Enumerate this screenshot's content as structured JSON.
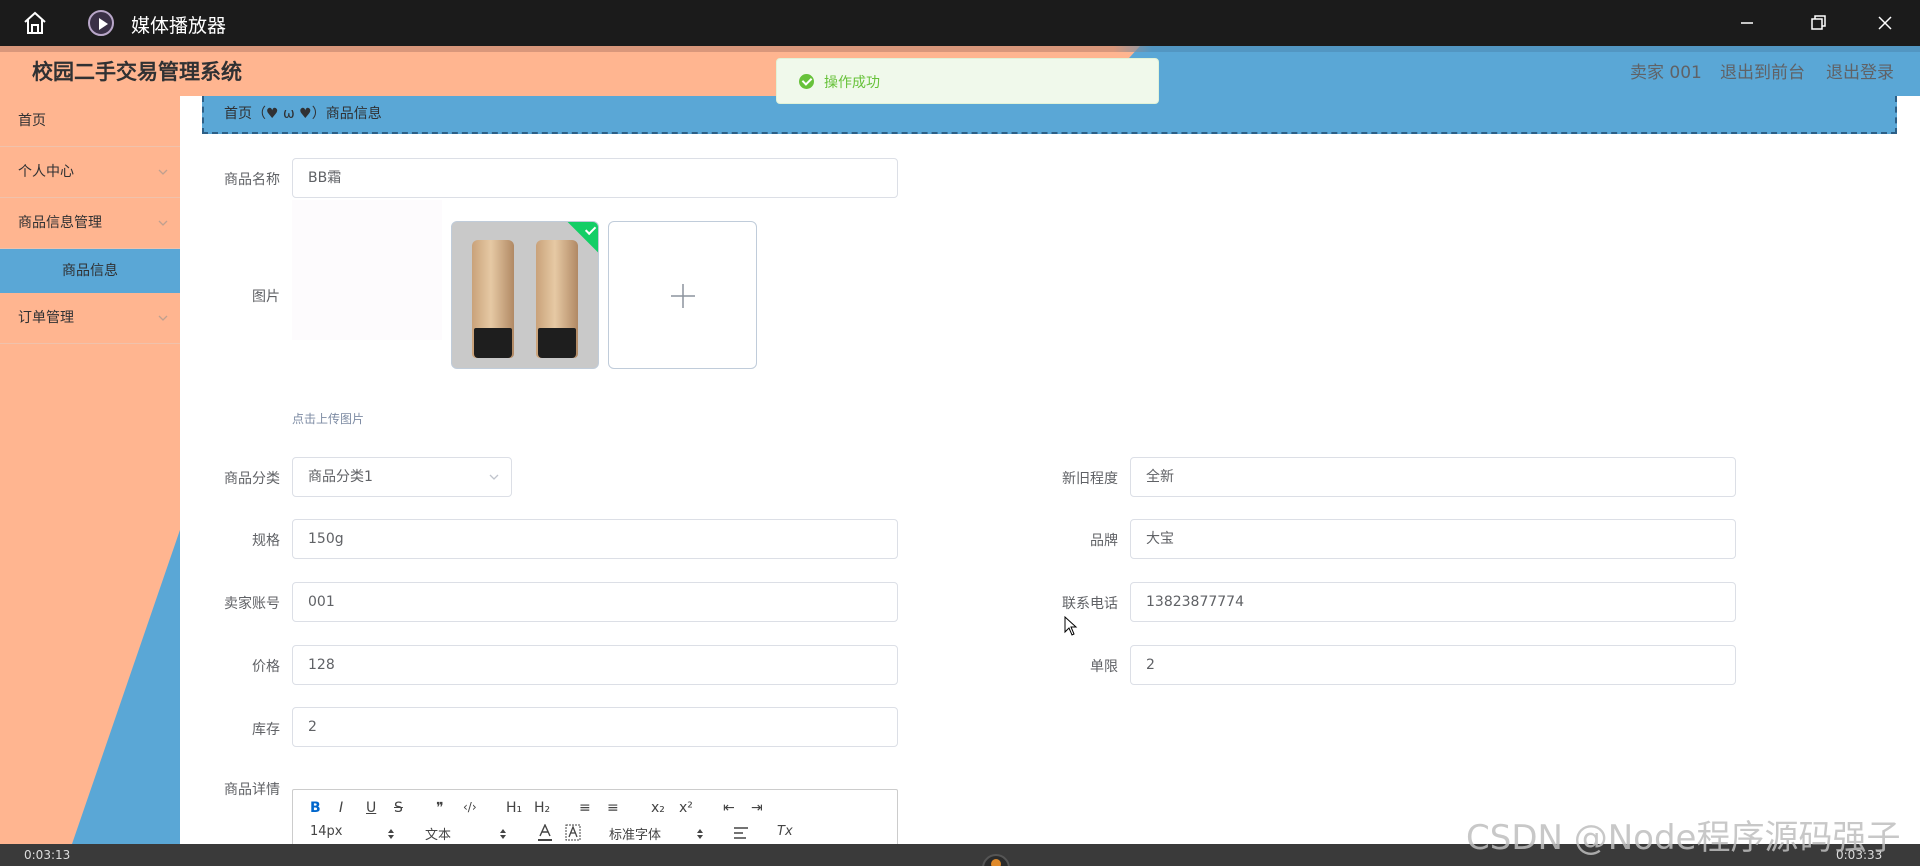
{
  "window": {
    "title": "媒体播放器"
  },
  "header": {
    "system_title": "校园二手交易管理系统",
    "user": "卖家 001",
    "to_front": "退出到前台",
    "logout": "退出登录"
  },
  "sidebar": {
    "items": [
      {
        "label": "首页"
      },
      {
        "label": "个人中心"
      },
      {
        "label": "商品信息管理"
      },
      {
        "label": "商品信息"
      },
      {
        "label": "订单管理"
      }
    ]
  },
  "breadcrumb": {
    "text": "首页（♥ ω ♥）商品信息"
  },
  "toast": {
    "text": "操作成功"
  },
  "form": {
    "name": {
      "label": "商品名称",
      "value": "BB霜"
    },
    "image": {
      "label": "图片",
      "tip": "点击上传图片"
    },
    "category": {
      "label": "商品分类",
      "value": "商品分类1"
    },
    "condition": {
      "label": "新旧程度",
      "value": "全新"
    },
    "spec": {
      "label": "规格",
      "value": "150g"
    },
    "brand": {
      "label": "品牌",
      "value": "大宝"
    },
    "seller_account": {
      "label": "卖家账号",
      "value": "001"
    },
    "phone": {
      "label": "联系电话",
      "value": "13823877774"
    },
    "price": {
      "label": "价格",
      "value": "128"
    },
    "limit": {
      "label": "单限",
      "value": "2"
    },
    "stock": {
      "label": "库存",
      "value": "2"
    },
    "detail": {
      "label": "商品详情"
    }
  },
  "editor": {
    "toolbar": {
      "bold": "B",
      "italic": "I",
      "underline": "U",
      "strike": "S",
      "quote": "❞",
      "code": "‹/›",
      "h1": "H₁",
      "h2": "H₂",
      "ordered": "≡",
      "bullet": "≡",
      "sub": "x₂",
      "sup": "x²",
      "outdent": "⇤",
      "indent": "⇥",
      "size": "14px",
      "type": "文本",
      "font": "标准字体",
      "clear": "Tx"
    }
  },
  "player": {
    "time_left": "0:03:13",
    "time_right": "0:03:33"
  },
  "watermark": "CSDN @Node程序源码强子"
}
